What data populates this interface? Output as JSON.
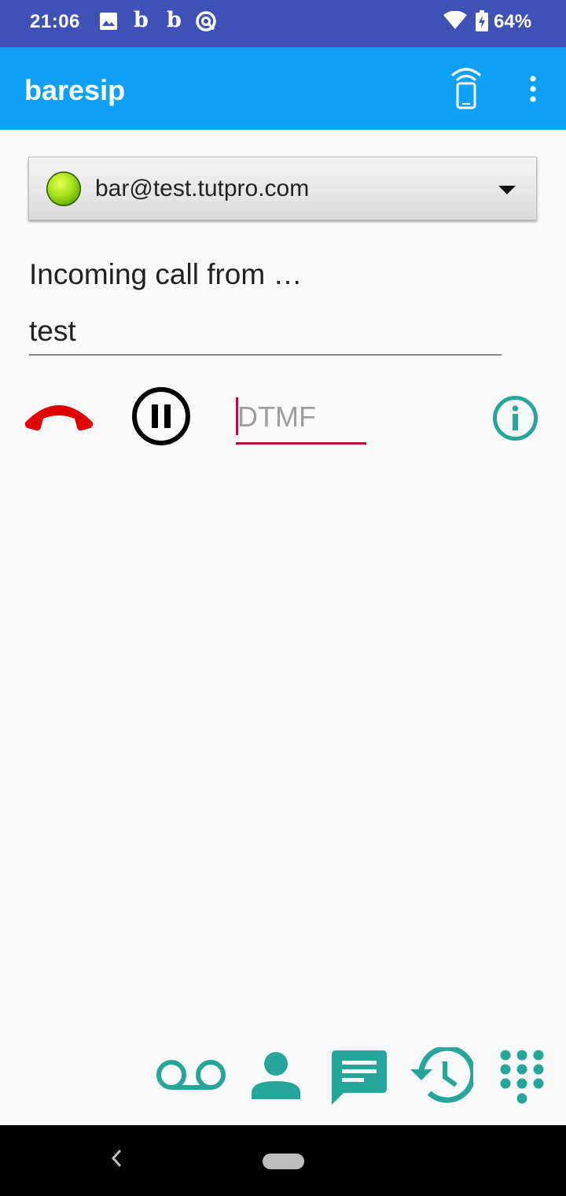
{
  "status_bar": {
    "time": "21:06",
    "notification_b1": "b",
    "notification_b2": "b",
    "battery": "64%"
  },
  "app_bar": {
    "title": "baresip",
    "icons": [
      "phone-signal-icon",
      "more-vert-icon"
    ]
  },
  "account": {
    "label": "bar@test.tutpro.com",
    "status_color": "#8bd41a"
  },
  "call": {
    "title": "Incoming call from …",
    "peer": "test",
    "dtmf_placeholder": "DTMF"
  },
  "colors": {
    "status_bar": "#3f51b5",
    "app_bar": "#11a0f8",
    "accent_teal": "#26a69a",
    "hangup_red": "#e00000",
    "dtmf_underline": "#b01038"
  },
  "bottom_nav": [
    "voicemail-icon",
    "contacts-icon",
    "messages-icon",
    "call-history-icon",
    "dialpad-icon"
  ]
}
